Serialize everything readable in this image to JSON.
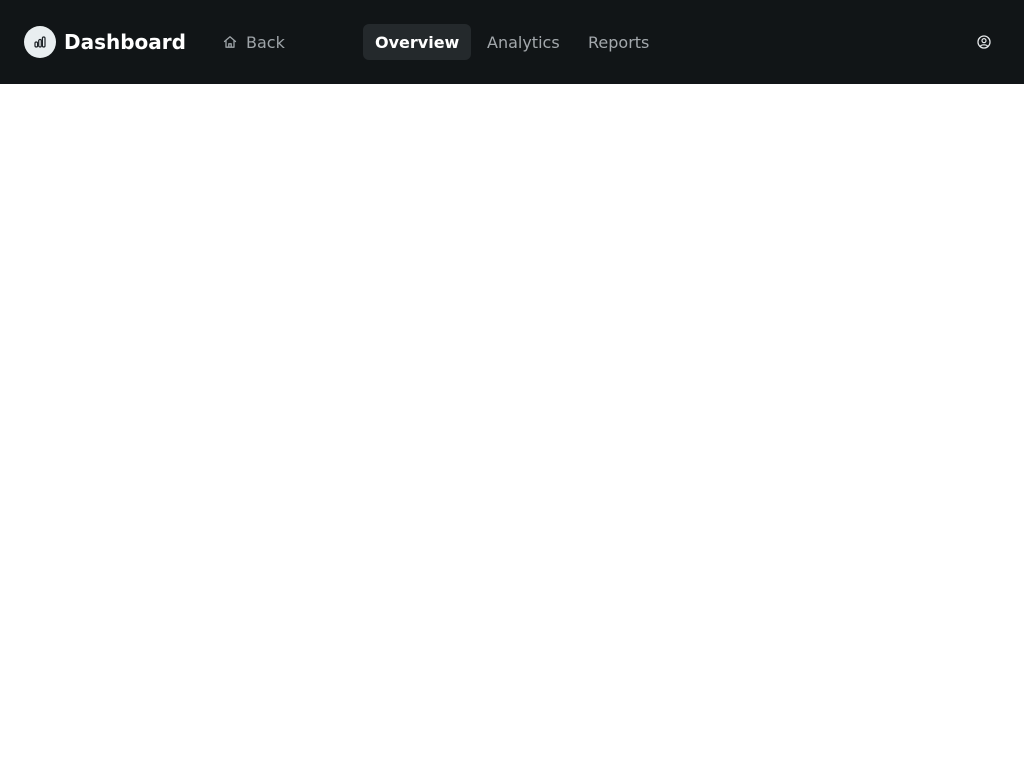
{
  "header": {
    "brand": {
      "title": "Dashboard",
      "icon": "bar-chart-icon"
    },
    "back": {
      "label": "Back",
      "icon": "home-icon"
    },
    "tabs": [
      {
        "label": "Overview",
        "active": true
      },
      {
        "label": "Analytics",
        "active": false
      },
      {
        "label": "Reports",
        "active": false
      }
    ],
    "profile_icon": "user-circle-icon"
  },
  "colors": {
    "header_bg": "#111517",
    "active_tab_bg": "#24292c",
    "muted_text": "#a3a8ac",
    "page_bg": "#ffffff"
  }
}
